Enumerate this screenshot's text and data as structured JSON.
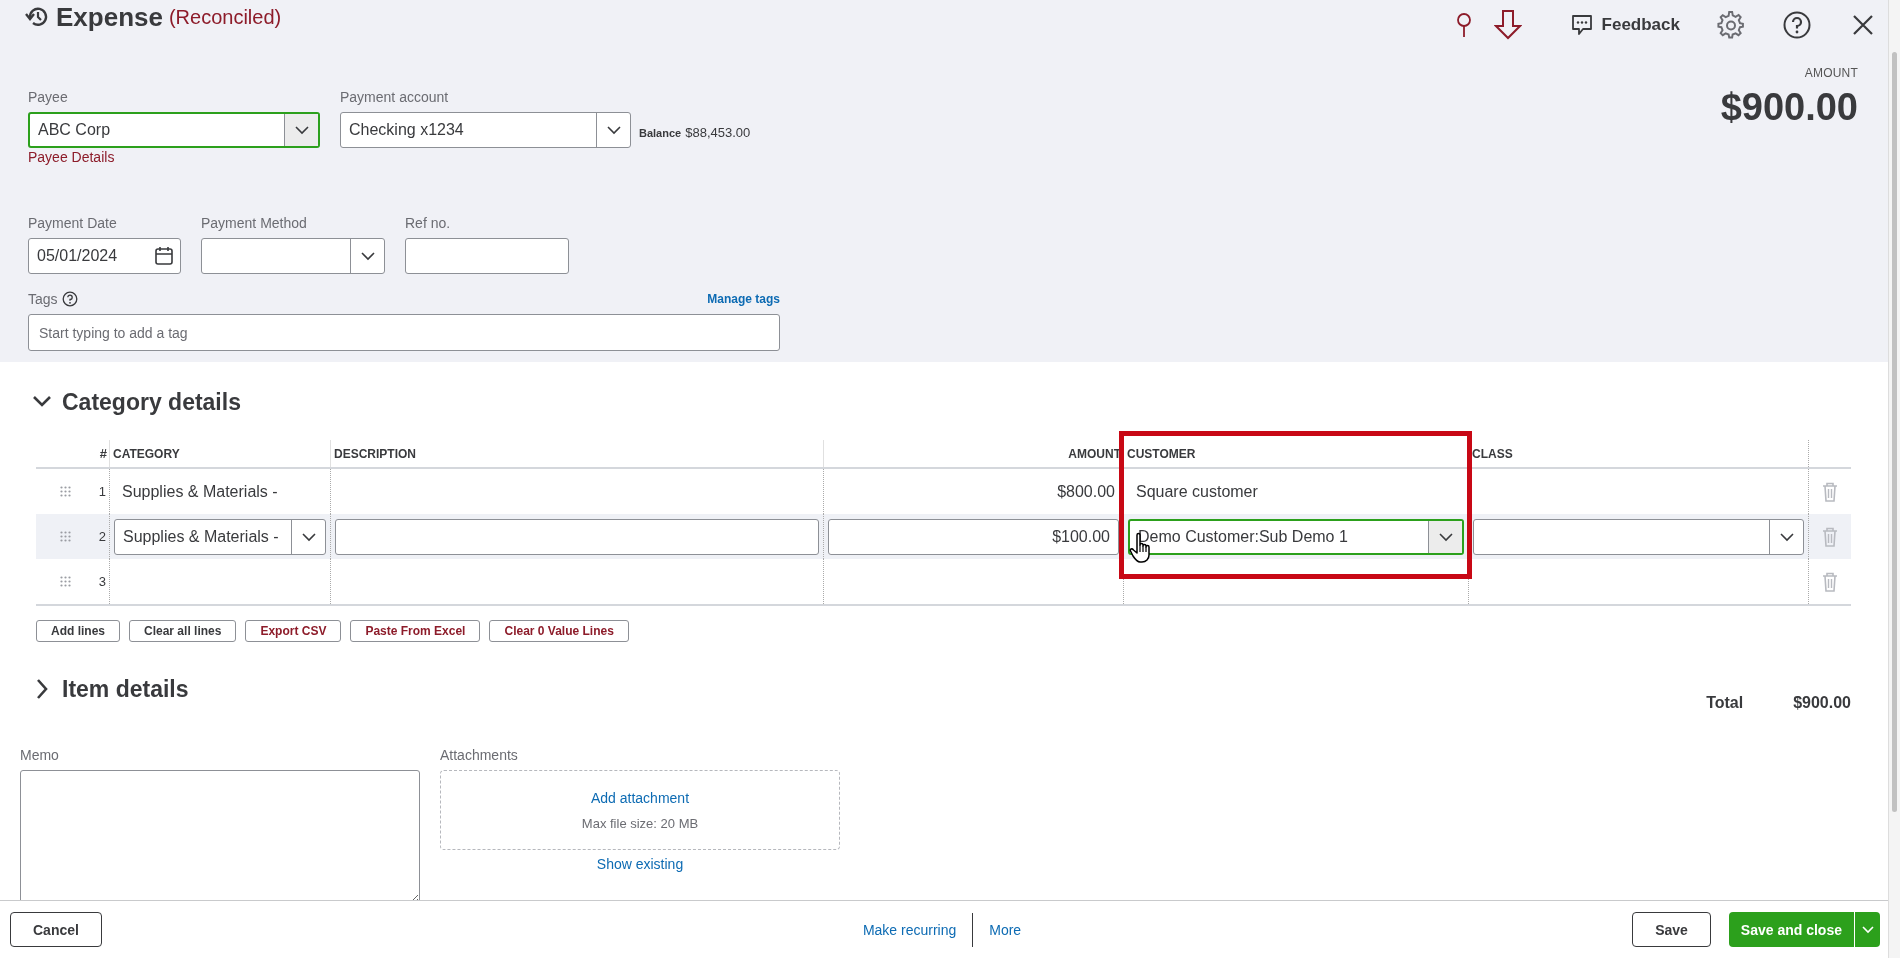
{
  "header": {
    "title": "Expense",
    "status": "(Reconciled)",
    "feedback": "Feedback"
  },
  "amount": {
    "label": "AMOUNT",
    "value": "$900.00"
  },
  "payee": {
    "label": "Payee",
    "value": "ABC Corp",
    "focused": true,
    "details_link": "Payee Details"
  },
  "payment_account": {
    "label": "Payment account",
    "value": "Checking x1234",
    "balance_label": "Balance",
    "balance": "$88,453.00"
  },
  "payment_date": {
    "label": "Payment Date",
    "value": "05/01/2024"
  },
  "payment_method": {
    "label": "Payment Method"
  },
  "ref_no": {
    "label": "Ref no."
  },
  "tags": {
    "label": "Tags",
    "manage_link": "Manage tags",
    "placeholder": "Start typing to add a tag"
  },
  "category_details": {
    "title": "Category details",
    "expanded": true,
    "columns": [
      {
        "label": "#",
        "highlighted": false
      },
      {
        "label": "CATEGORY",
        "highlighted": false
      },
      {
        "label": "DESCRIPTION",
        "highlighted": false
      },
      {
        "label": "AMOUNT",
        "highlighted": false
      },
      {
        "label": "CUSTOMER",
        "highlighted": true
      },
      {
        "label": "CLASS",
        "highlighted": false
      }
    ],
    "rows": [
      {
        "number": "1",
        "category": "Supplies & Materials -",
        "amount": "$800.00",
        "customer": "Square customer",
        "editing": false
      },
      {
        "number": "2",
        "category": "Supplies & Materials -",
        "amount": "$100.00",
        "customer": "Demo Customer:Sub Demo 1",
        "editing": true,
        "customer_focused": true
      },
      {
        "number": "3",
        "editing": false
      }
    ],
    "buttons": [
      {
        "label": "Add lines",
        "kind": "default"
      },
      {
        "label": "Clear all lines",
        "kind": "default"
      },
      {
        "label": "Export CSV",
        "kind": "accent"
      },
      {
        "label": "Paste From Excel",
        "kind": "accent"
      },
      {
        "label": "Clear 0 Value Lines",
        "kind": "accent"
      }
    ]
  },
  "item_details": {
    "title": "Item details",
    "expanded": false
  },
  "total": {
    "label": "Total",
    "value": "$900.00"
  },
  "memo": {
    "label": "Memo"
  },
  "attachments": {
    "label": "Attachments",
    "add_link": "Add attachment",
    "max_size": "Max file size: 20 MB",
    "show_existing": "Show existing"
  },
  "footer": {
    "cancel": "Cancel",
    "make_recurring": "Make recurring",
    "more": "More",
    "save": "Save",
    "save_and_close": "Save and close"
  }
}
